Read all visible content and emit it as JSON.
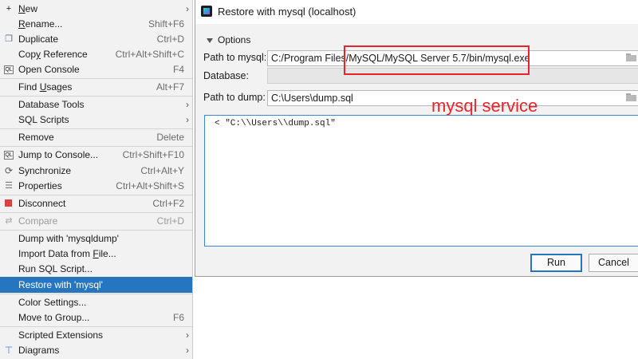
{
  "menu": {
    "items": [
      {
        "label": "New",
        "underline": "N",
        "shortcut": "",
        "arrow": true,
        "icon": "plus-icon"
      },
      {
        "label": "Rename...",
        "underline": "R",
        "shortcut": "Shift+F6",
        "arrow": false,
        "icon": ""
      },
      {
        "label": "Duplicate",
        "underline": "",
        "shortcut": "Ctrl+D",
        "arrow": false,
        "icon": "duplicate-icon"
      },
      {
        "label": "Copy Reference",
        "underline": "y",
        "shortcut": "Ctrl+Alt+Shift+C",
        "arrow": false,
        "icon": ""
      },
      {
        "label": "Open Console",
        "underline": "",
        "shortcut": "F4",
        "arrow": false,
        "icon": "console-icon"
      },
      {
        "label": "Find Usages",
        "underline": "U",
        "shortcut": "Alt+F7",
        "arrow": false,
        "icon": ""
      },
      {
        "label": "Database Tools",
        "underline": "",
        "shortcut": "",
        "arrow": true,
        "icon": ""
      },
      {
        "label": "SQL Scripts",
        "underline": "",
        "shortcut": "",
        "arrow": true,
        "icon": ""
      },
      {
        "label": "Remove",
        "underline": "",
        "shortcut": "Delete",
        "arrow": false,
        "icon": ""
      },
      {
        "label": "Jump to Console...",
        "underline": "",
        "shortcut": "Ctrl+Shift+F10",
        "arrow": false,
        "icon": "console-icon"
      },
      {
        "label": "Synchronize",
        "underline": "",
        "shortcut": "Ctrl+Alt+Y",
        "arrow": false,
        "icon": "sync-icon"
      },
      {
        "label": "Properties",
        "underline": "",
        "shortcut": "Ctrl+Alt+Shift+S",
        "arrow": false,
        "icon": "properties-icon"
      },
      {
        "label": "Disconnect",
        "underline": "",
        "shortcut": "Ctrl+F2",
        "arrow": false,
        "icon": "stop-icon"
      },
      {
        "label": "Compare",
        "underline": "",
        "shortcut": "Ctrl+D",
        "arrow": false,
        "icon": "compare-icon",
        "disabled": true
      },
      {
        "label": "Dump with 'mysqldump'",
        "underline": "",
        "shortcut": "",
        "arrow": false,
        "icon": ""
      },
      {
        "label": "Import Data from File...",
        "underline": "F",
        "shortcut": "",
        "arrow": false,
        "icon": ""
      },
      {
        "label": "Run SQL Script...",
        "underline": "",
        "shortcut": "",
        "arrow": false,
        "icon": ""
      },
      {
        "label": "Restore with 'mysql'",
        "underline": "",
        "shortcut": "",
        "arrow": false,
        "icon": "",
        "selected": true
      },
      {
        "label": "Color Settings...",
        "underline": "",
        "shortcut": "",
        "arrow": false,
        "icon": ""
      },
      {
        "label": "Move to Group...",
        "underline": "",
        "shortcut": "F6",
        "arrow": false,
        "icon": ""
      },
      {
        "label": "Scripted Extensions",
        "underline": "",
        "shortcut": "",
        "arrow": true,
        "icon": ""
      },
      {
        "label": "Diagrams",
        "underline": "",
        "shortcut": "",
        "arrow": true,
        "icon": "diagram-icon"
      }
    ]
  },
  "dialog": {
    "title": "Restore with mysql (localhost)",
    "options_header": "Options",
    "path_to_mysql_label": "Path to mysql:",
    "path_to_mysql_value": "C:/Program Files/MySQL/MySQL Server 5.7/bin/mysql.exe",
    "database_label": "Database:",
    "database_value": "",
    "path_to_dump_label": "Path to dump:",
    "path_to_dump_value": "C:\\Users\\dump.sql",
    "command_preview": "< \"C:\\\\Users\\\\dump.sql\"",
    "run_label": "Run",
    "cancel_label": "Cancel"
  },
  "annotation": {
    "text": "mysql service",
    "color": "#e8232a"
  },
  "colors": {
    "selection": "#2675bf",
    "menu_bg": "#f2f2f2"
  }
}
